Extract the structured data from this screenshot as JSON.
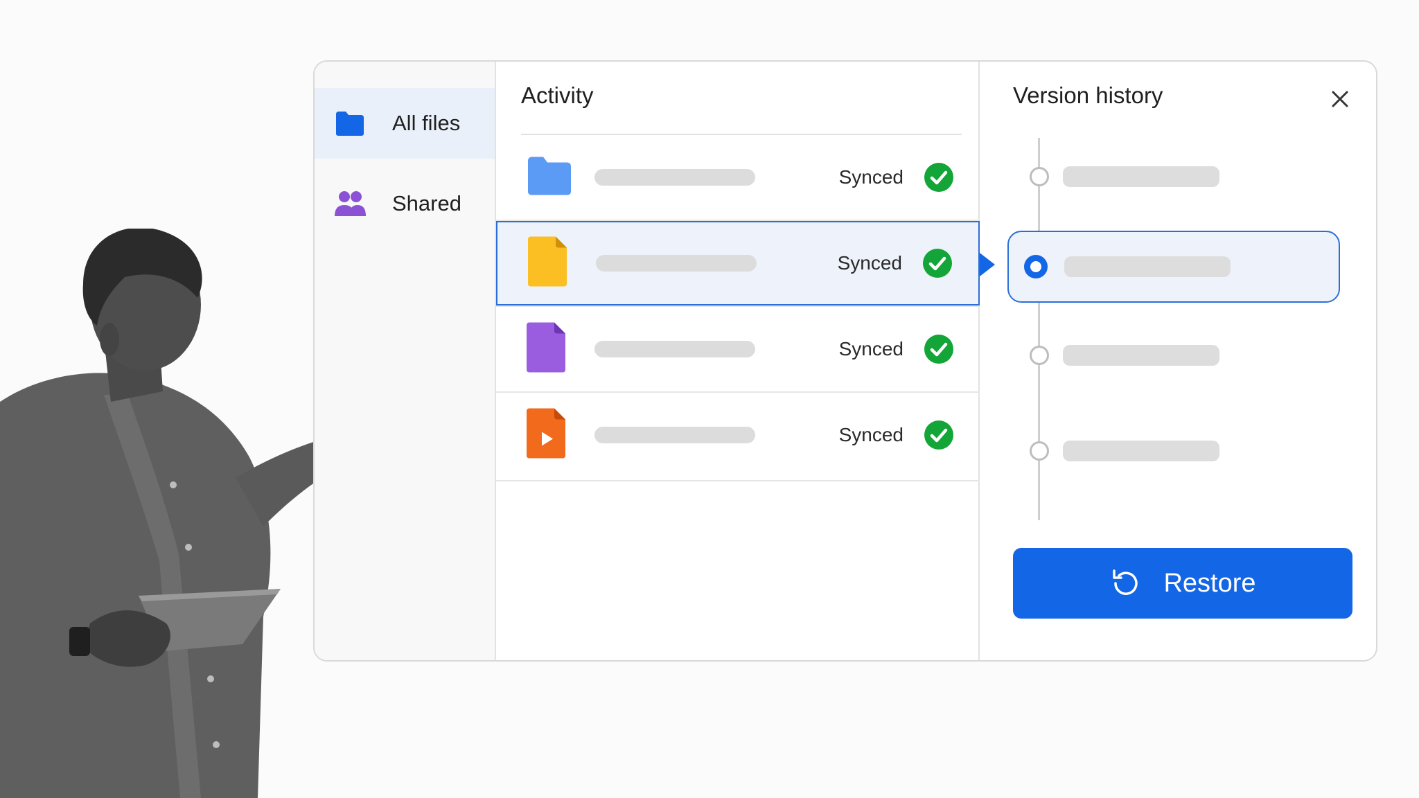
{
  "sidebar": {
    "items": [
      {
        "label": "All files",
        "icon": "folder-icon",
        "active": true
      },
      {
        "label": "Shared",
        "icon": "people-icon",
        "active": false
      }
    ]
  },
  "activity": {
    "title": "Activity",
    "rows": [
      {
        "icon": "folder-icon",
        "color": "#5b9af5",
        "status": "Synced"
      },
      {
        "icon": "document-icon",
        "color": "#fbbf24",
        "status": "Synced",
        "selected": true
      },
      {
        "icon": "document-icon",
        "color": "#9b5de0",
        "status": "Synced"
      },
      {
        "icon": "video-file-icon",
        "color": "#f26b1d",
        "status": "Synced"
      }
    ]
  },
  "history": {
    "title": "Version history",
    "restore_label": "Restore"
  },
  "colors": {
    "accent": "#1366e5",
    "synced": "#13a538",
    "selection_bg": "#eef3fb"
  }
}
